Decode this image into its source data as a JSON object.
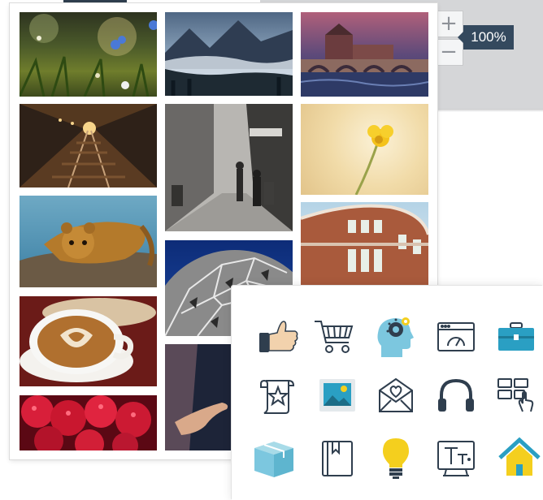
{
  "zoom": {
    "zoom_in_label": "+",
    "zoom_out_label": "−",
    "level": "100%"
  },
  "gallery": {
    "photos": [
      "wildflowers-meadow",
      "misty-mountain-valley",
      "bridge-castle-painting",
      "railway-tunnel",
      "old-street-people",
      "yellow-flower",
      "fossa-animal",
      "geodesic-sphere",
      "brick-building",
      "latte-art-coffee",
      "raspberries",
      "hands-touch"
    ]
  },
  "icons": [
    {
      "name": "thumbs-up-icon"
    },
    {
      "name": "shopping-cart-icon"
    },
    {
      "name": "head-gear-icon"
    },
    {
      "name": "browser-speed-icon"
    },
    {
      "name": "briefcase-icon"
    },
    {
      "name": "scroll-star-icon"
    },
    {
      "name": "image-icon"
    },
    {
      "name": "envelope-heart-icon"
    },
    {
      "name": "headphones-icon"
    },
    {
      "name": "grid-touch-icon"
    },
    {
      "name": "box-icon"
    },
    {
      "name": "book-icon"
    },
    {
      "name": "lightbulb-icon"
    },
    {
      "name": "text-format-icon"
    },
    {
      "name": "home-icon"
    }
  ],
  "colors": {
    "zoom_label_bg": "#34495e",
    "accent_blue": "#2a9fc3",
    "icon_outline": "#2f3e4e",
    "yellow": "#f4cf1e"
  }
}
